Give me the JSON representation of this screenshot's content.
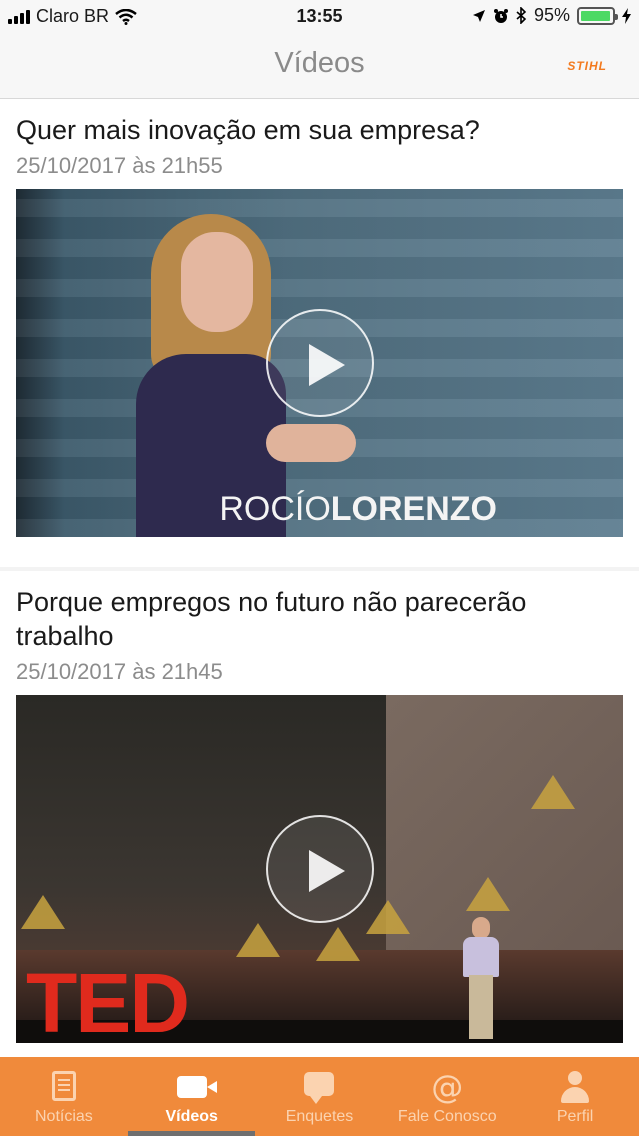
{
  "status_bar": {
    "carrier": "Claro BR",
    "time": "13:55",
    "battery_percent": "95%",
    "battery_level": 0.95,
    "icons": [
      "signal-icon",
      "wifi-icon",
      "location-icon",
      "alarm-icon",
      "bluetooth-icon",
      "battery-icon",
      "charging-icon"
    ]
  },
  "header": {
    "title": "Vídeos",
    "brand": "STIHL"
  },
  "videos": [
    {
      "title": "Quer mais inovação em sua empresa?",
      "date": "25/10/2017 às 21h55",
      "caption_light": "ROCÍO",
      "caption_bold": "LORENZO"
    },
    {
      "title": "Porque empregos no futuro não parecerão trabalho",
      "date": "25/10/2017 às 21h45",
      "stage_text": "TED"
    }
  ],
  "tabs": [
    {
      "label": "Notícias",
      "icon": "news-icon",
      "active": false
    },
    {
      "label": "Vídeos",
      "icon": "video-camera-icon",
      "active": true
    },
    {
      "label": "Enquetes",
      "icon": "chat-bubble-icon",
      "active": false
    },
    {
      "label": "Fale Conosco",
      "icon": "at-sign-icon",
      "active": false
    },
    {
      "label": "Perfil",
      "icon": "user-icon",
      "active": false
    }
  ],
  "colors": {
    "accent": "#f08a3b",
    "tab_inactive": "#fbd3b0",
    "tab_active": "#ffffff",
    "battery_fill": "#4cd964"
  }
}
